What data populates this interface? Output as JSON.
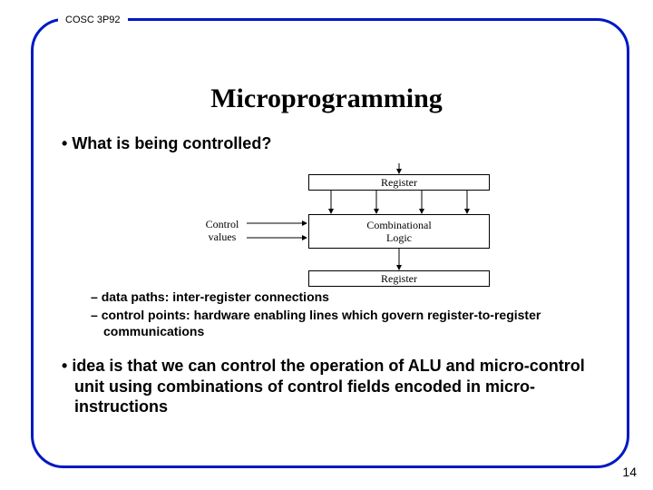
{
  "course": "COSC 3P92",
  "title": "Microprogramming",
  "bullet1": "What is being controlled?",
  "diagram": {
    "reg_top": "Register",
    "comb_line1": "Combinational",
    "comb_line2": "Logic",
    "reg_bot": "Register",
    "ctrl_line1": "Control",
    "ctrl_line2": "values"
  },
  "sub1": "data paths:  inter-register connections",
  "sub2": "control points:  hardware enabling lines which  govern register-to-register communications",
  "bullet2": "idea is that we can control the operation of ALU and micro-control unit using combinations of control fields encoded in micro-instructions",
  "page": "14"
}
